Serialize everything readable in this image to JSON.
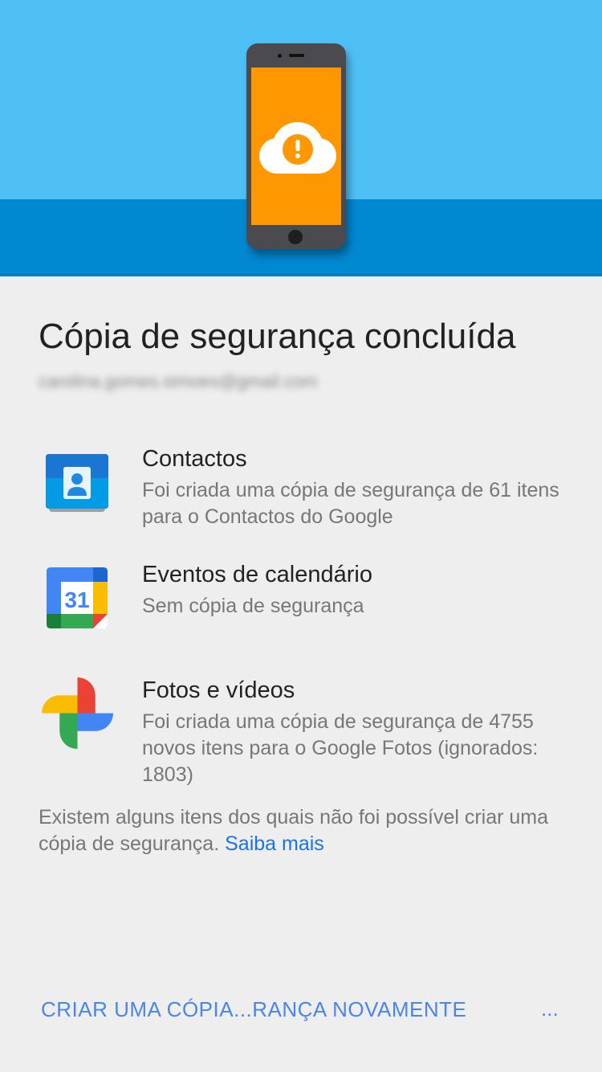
{
  "header": {
    "title": "Cópia de segurança concluída",
    "account_email": "carolina.gomes.simoes@gmail.com"
  },
  "items": [
    {
      "icon": "contacts-icon",
      "title": "Contactos",
      "description": "Foi criada uma cópia de segurança de 61 itens para o Contactos do Google"
    },
    {
      "icon": "calendar-icon",
      "icon_text": "31",
      "title": "Eventos de calendário",
      "description": "Sem cópia de segurança"
    },
    {
      "icon": "google-photos-icon",
      "title": "Fotos e vídeos",
      "description": "Foi criada uma cópia de segurança de 4755 novos itens para o Google Fotos (ignorados: 1803)"
    }
  ],
  "footnote": {
    "text": "Existem alguns itens dos quais não foi possível criar uma cópia de segurança.",
    "link": "Saiba mais"
  },
  "actions": {
    "primary": "CRIAR UMA CÓPIA...RANÇA NOVAMENTE",
    "more": "..."
  },
  "colors": {
    "hero_light": "#4fc0f6",
    "hero_dark": "#0088d1",
    "phone_screen": "#ff9800",
    "link": "#1a73e8",
    "button": "#4a86e8"
  }
}
